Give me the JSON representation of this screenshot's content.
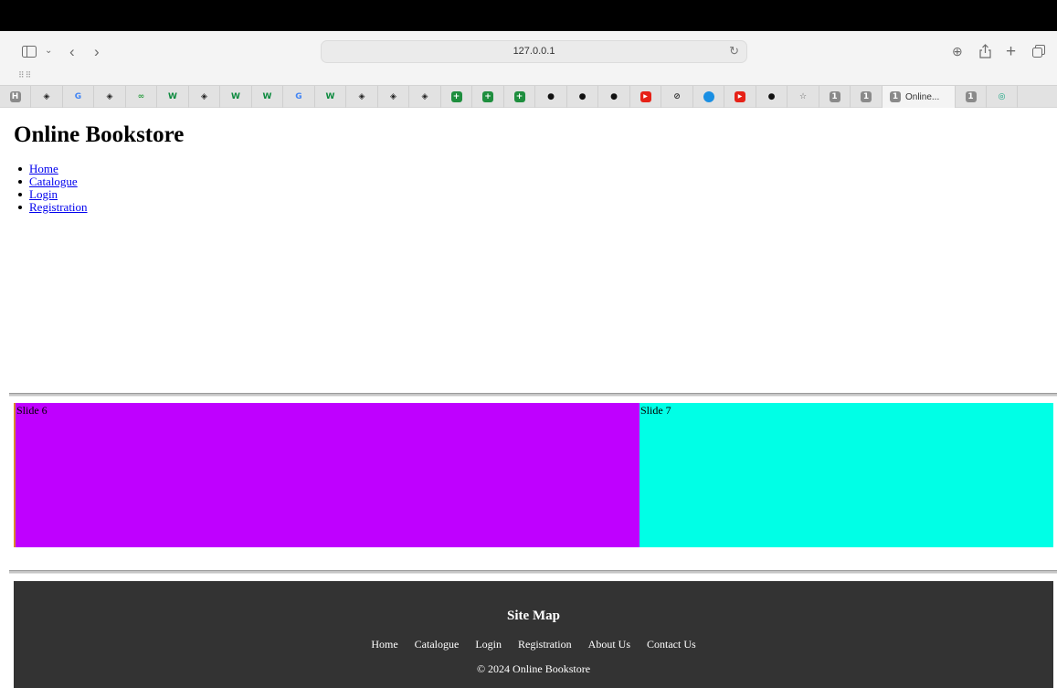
{
  "browser": {
    "url": "127.0.0.1",
    "tabs": [
      {
        "icon": "h-icon",
        "glyph": "H",
        "color": "#8a8a8a"
      },
      {
        "icon": "codepen-icon",
        "glyph": "◈",
        "color": "#222222"
      },
      {
        "icon": "google-icon",
        "glyph": "G",
        "color": "#4285f4"
      },
      {
        "icon": "codepen-icon",
        "glyph": "◈",
        "color": "#222222"
      },
      {
        "icon": "infinity-icon",
        "glyph": "∞",
        "color": "#2f9e44"
      },
      {
        "icon": "w-icon",
        "glyph": "W",
        "color": "#0c8a3e"
      },
      {
        "icon": "codepen-icon",
        "glyph": "◈",
        "color": "#222222"
      },
      {
        "icon": "w-icon",
        "glyph": "W",
        "color": "#0c8a3e"
      },
      {
        "icon": "w-icon",
        "glyph": "W",
        "color": "#0c8a3e"
      },
      {
        "icon": "google-icon",
        "glyph": "G",
        "color": "#4285f4"
      },
      {
        "icon": "w-icon",
        "glyph": "W",
        "color": "#0c8a3e"
      },
      {
        "icon": "codepen-icon",
        "glyph": "◈",
        "color": "#222222"
      },
      {
        "icon": "codepen-icon",
        "glyph": "◈",
        "color": "#222222"
      },
      {
        "icon": "codepen-icon",
        "glyph": "◈",
        "color": "#222222"
      },
      {
        "icon": "sheets-icon",
        "glyph": "+",
        "color": "#1e8e3e"
      },
      {
        "icon": "sheets-icon",
        "glyph": "+",
        "color": "#1e8e3e"
      },
      {
        "icon": "sheets-icon",
        "glyph": "+",
        "color": "#1e8e3e"
      },
      {
        "icon": "github-icon",
        "glyph": "●",
        "color": "#111111"
      },
      {
        "icon": "github-icon",
        "glyph": "●",
        "color": "#111111"
      },
      {
        "icon": "github-icon",
        "glyph": "●",
        "color": "#111111"
      },
      {
        "icon": "youtube-icon",
        "glyph": "▶",
        "color": "#e62117"
      },
      {
        "icon": "link-icon",
        "glyph": "⊘",
        "color": "#333333"
      },
      {
        "icon": "info-icon",
        "glyph": "●",
        "color": "#1a8fe3"
      },
      {
        "icon": "youtube-icon",
        "glyph": "▶",
        "color": "#e62117"
      },
      {
        "icon": "github-icon",
        "glyph": "●",
        "color": "#111111"
      },
      {
        "icon": "star-icon",
        "glyph": "☆",
        "color": "#666666"
      },
      {
        "icon": "one-icon",
        "glyph": "1",
        "color": "#8a8a8a"
      },
      {
        "icon": "one-icon",
        "glyph": "1",
        "color": "#8a8a8a"
      }
    ],
    "active_tab": {
      "glyph": "1",
      "label": "Online..."
    },
    "trailing_tabs": [
      {
        "icon": "one-icon",
        "glyph": "1",
        "color": "#8a8a8a"
      },
      {
        "icon": "openai-icon",
        "glyph": "◎",
        "color": "#10a37f"
      }
    ]
  },
  "page": {
    "title": "Online Bookstore",
    "nav": [
      "Home",
      "Catalogue",
      "Login",
      "Registration"
    ],
    "slides": [
      {
        "label": "Slide 6",
        "color": "#bf00ff"
      },
      {
        "label": "Slide 7",
        "color": "#00ffe6"
      }
    ],
    "footer": {
      "heading": "Site Map",
      "links": [
        "Home",
        "Catalogue",
        "Login",
        "Registration",
        "About Us",
        "Contact Us"
      ],
      "copyright": "© 2024 Online Bookstore",
      "bg": "#333333"
    }
  }
}
